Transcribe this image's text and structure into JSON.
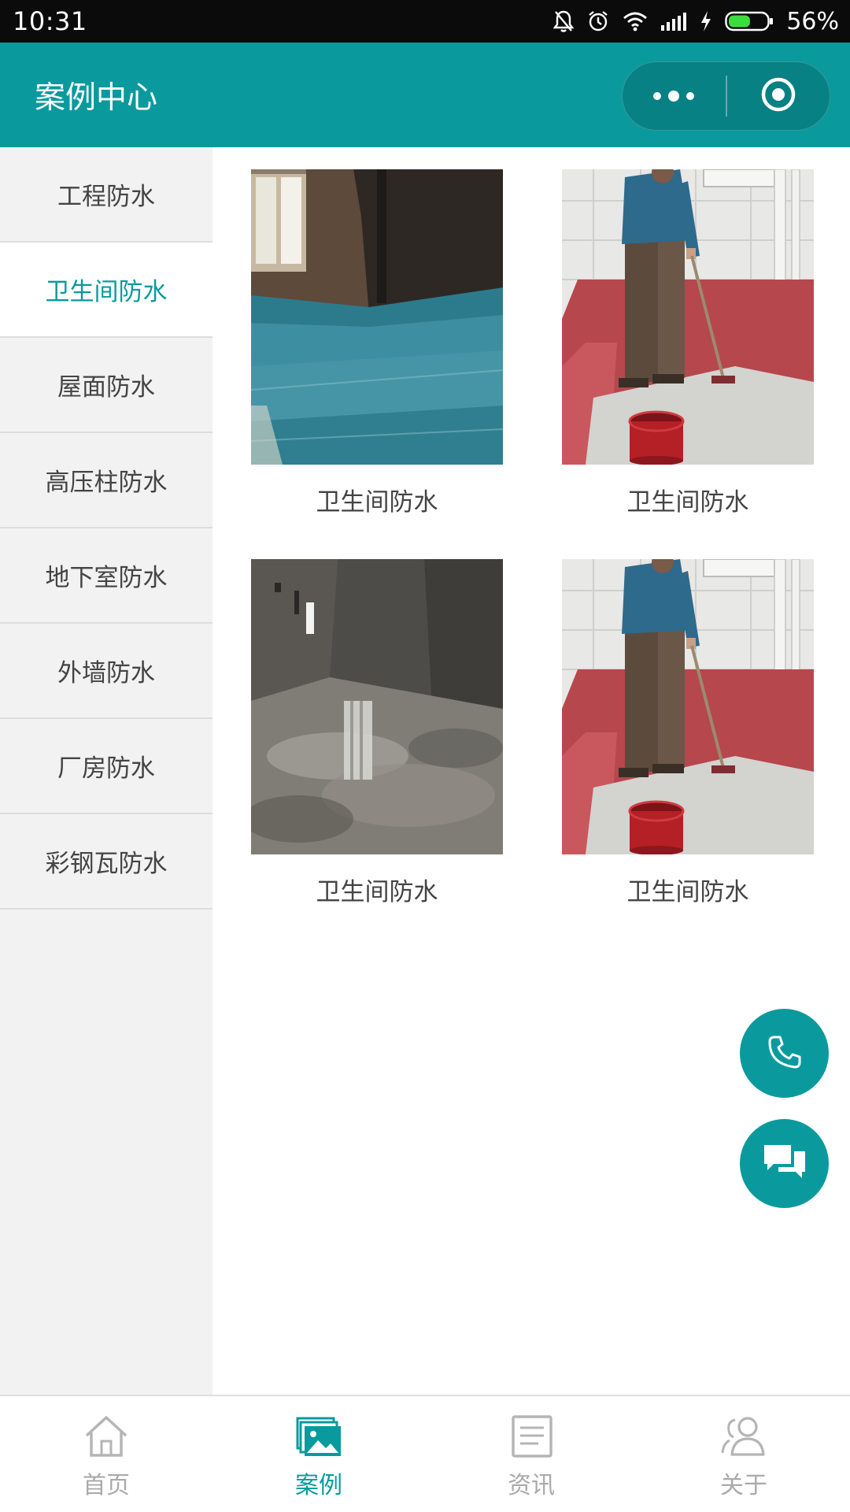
{
  "status_bar": {
    "time": "10:31",
    "battery_percent": "56%",
    "battery_level": 0.56,
    "icons": [
      "bell-mute-icon",
      "alarm-icon",
      "wifi-icon",
      "signal-icon",
      "charging-icon",
      "battery-icon"
    ]
  },
  "header": {
    "title": "案例中心",
    "menu_icon": "more-dots-icon",
    "close_icon": "target-close-icon",
    "bg_color": "#0a9a9e"
  },
  "sidebar": {
    "active_index": 1,
    "items": [
      {
        "label": "工程防水"
      },
      {
        "label": "卫生间防水"
      },
      {
        "label": "屋面防水"
      },
      {
        "label": "高压柱防水"
      },
      {
        "label": "地下室防水"
      },
      {
        "label": "外墙防水"
      },
      {
        "label": "厂房防水"
      },
      {
        "label": "彩钢瓦防水"
      }
    ]
  },
  "cases": [
    {
      "caption": "卫生间防水",
      "image": "blue-coated-room-photo"
    },
    {
      "caption": "卫生间防水",
      "image": "worker-painting-red-floor-photo"
    },
    {
      "caption": "卫生间防水",
      "image": "grey-wet-floor-photo"
    },
    {
      "caption": "卫生间防水",
      "image": "worker-painting-red-floor-photo"
    }
  ],
  "floating": {
    "phone_icon": "phone-icon",
    "chat_icon": "chat-icon"
  },
  "tabbar": {
    "active_index": 1,
    "tabs": [
      {
        "label": "首页",
        "icon": "home-icon"
      },
      {
        "label": "案例",
        "icon": "gallery-icon"
      },
      {
        "label": "资讯",
        "icon": "news-icon"
      },
      {
        "label": "关于",
        "icon": "about-users-icon"
      }
    ]
  },
  "colors": {
    "accent": "#0a9a9e",
    "inactive": "#aaaaaa",
    "text": "#444444"
  }
}
